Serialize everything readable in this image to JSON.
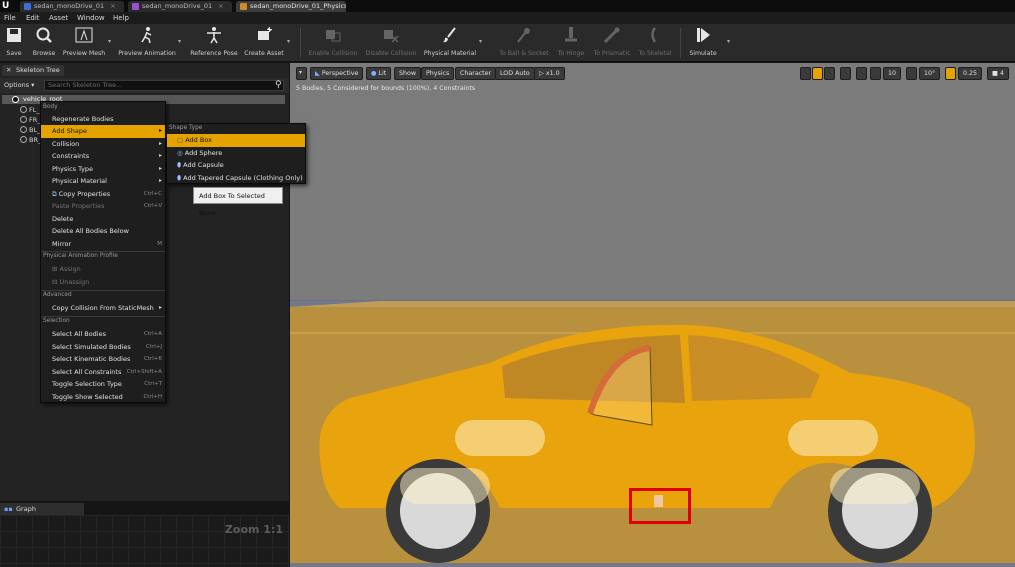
{
  "tabs": [
    {
      "label": "sedan_monoDrive_01",
      "active": false
    },
    {
      "label": "sedan_monoDrive_01",
      "active": false
    },
    {
      "label": "sedan_monoDrive_01_PhysicsAsset",
      "active": true
    }
  ],
  "menubar": [
    "File",
    "Edit",
    "Asset",
    "Window",
    "Help"
  ],
  "toolbar": {
    "save": "Save",
    "browse": "Browse",
    "preview_mesh": "Preview Mesh",
    "preview_animation": "Preview Animation",
    "reference_pose": "Reference Pose",
    "create_asset": "Create Asset",
    "enable_collision": "Enable Collision",
    "disable_collision": "Disable Collision",
    "physical_material": "Physical Material",
    "to_ball_socket": "To Ball & Socket",
    "to_hinge": "To Hinge",
    "to_prismatic": "To Prismatic",
    "to_skeletal": "To Skeletal",
    "simulate": "Simulate"
  },
  "skeleton_tree": {
    "tab_label": "Skeleton Tree",
    "options_label": "Options",
    "search_placeholder": "Search Skeleton Tree...",
    "root": "vehicle_root",
    "items": [
      "FL_",
      "FR_",
      "BL_",
      "BR_"
    ]
  },
  "context_menu": {
    "header_body": "Body",
    "regenerate": "Regenerate Bodies",
    "add_shape": "Add Shape",
    "collision": "Collision",
    "constraints": "Constraints",
    "physics_type": "Physics Type",
    "physical_material": "Physical Material",
    "copy_properties": "Copy Properties",
    "copy_sc": "Ctrl+C",
    "paste_properties": "Paste Properties",
    "paste_sc": "Ctrl+V",
    "delete": "Delete",
    "delete_all_below": "Delete All Bodies Below",
    "mirror": "Mirror",
    "mirror_sc": "M",
    "header_pap": "Physical Animation Profile",
    "assign": "Assign",
    "unassign": "Unassign",
    "header_advanced": "Advanced",
    "copy_collision": "Copy Collision From StaticMesh",
    "header_selection": "Selection",
    "select_all_bodies": "Select All Bodies",
    "sab_sc": "Ctrl+A",
    "select_simulated": "Select Simulated Bodies",
    "ssb_sc": "Ctrl+J",
    "select_kinematic": "Select Kinematic Bodies",
    "skb_sc": "Ctrl+K",
    "select_all_constraints": "Select All Constraints",
    "sac_sc": "Ctrl+Shift+A",
    "toggle_selection_type": "Toggle Selection Type",
    "tst_sc": "Ctrl+T",
    "toggle_show_selected": "Toggle Show Selected",
    "tss_sc": "Ctrl+H"
  },
  "submenu": {
    "header": "Shape Type",
    "add_box": "Add Box",
    "add_sphere": "Add Sphere",
    "add_capsule": "Add Capsule",
    "add_tapered": "Add Tapered Capsule (Clothing Only)"
  },
  "tooltip": "Add Box To Selected Bone",
  "viewport": {
    "perspective": "Perspective",
    "lit": "Lit",
    "show": "Show",
    "physics": "Physics",
    "character": "Character",
    "lod": "LOD Auto",
    "speed": "x1.0",
    "status": "5 Bodies, 5 Considered for bounds (100%), 4 Constraints",
    "grid": "10",
    "angle": "10°",
    "scale": "0.25",
    "cam": "4"
  },
  "graph": {
    "tab_label": "Graph",
    "zoom": "Zoom 1:1"
  },
  "colors": {
    "accent": "#e5a300",
    "highlight_box": "#e10000",
    "car_body": "#e9a40d"
  }
}
